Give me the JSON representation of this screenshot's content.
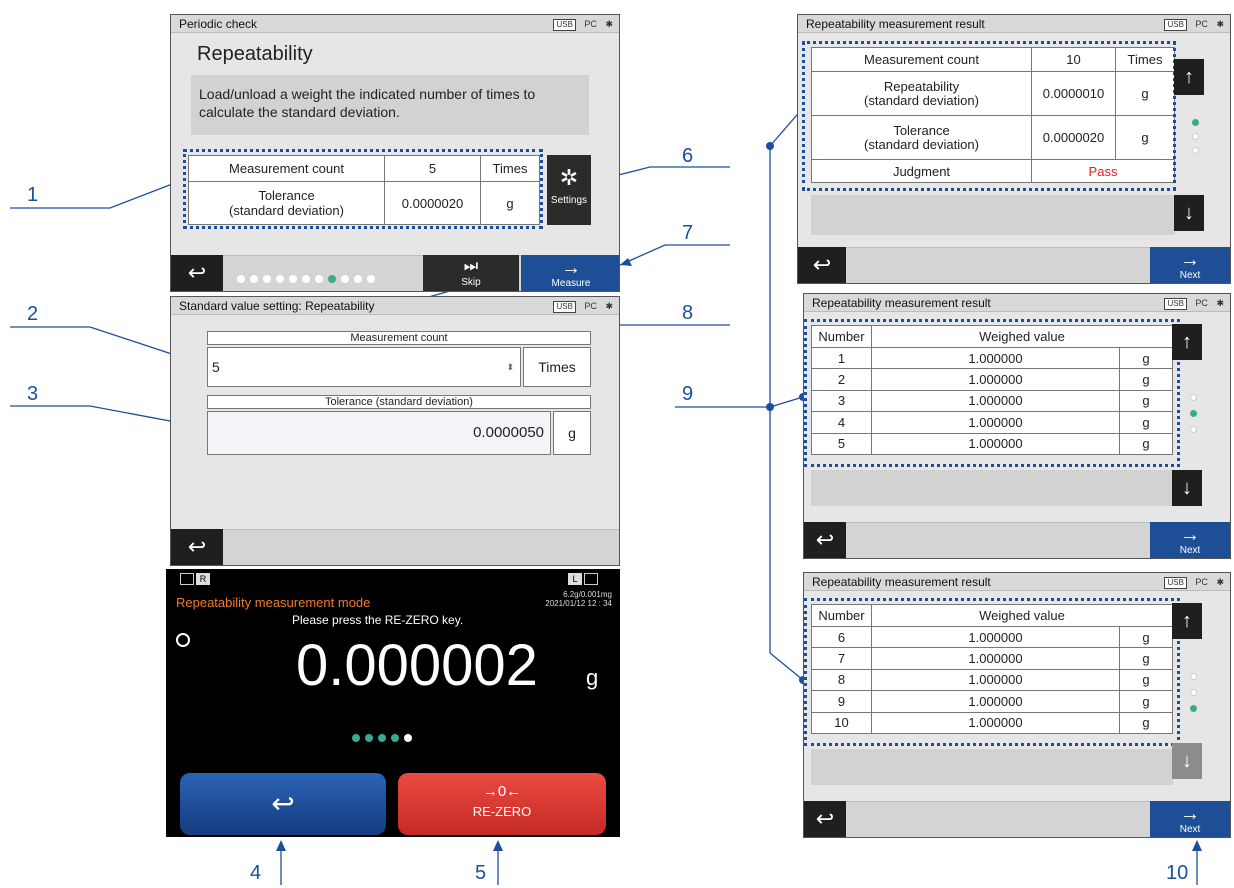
{
  "callouts": [
    "1",
    "2",
    "3",
    "4",
    "5",
    "6",
    "7",
    "8",
    "9",
    "10"
  ],
  "status": {
    "usb": "USB",
    "pc": "PC",
    "bt": "✱"
  },
  "screen_check": {
    "title": "Periodic check",
    "heading": "Repeatability",
    "instruction": "Load/unload a weight the indicated number of times to calculate the standard deviation.",
    "rows": [
      {
        "label": "Measurement count",
        "value": "5",
        "unit": "Times"
      },
      {
        "label": "Tolerance\n(standard deviation)",
        "value": "0.0000020",
        "unit": "g"
      }
    ],
    "settings_label": "Settings",
    "skip_label": "Skip",
    "measure_label": "Measure"
  },
  "screen_setting": {
    "title": "Standard value setting: Repeatability",
    "count_header": "Measurement count",
    "count_value": "5",
    "count_unit": "Times",
    "tol_header": "Tolerance (standard deviation)",
    "tol_value": "0.0000050",
    "tol_unit": "g"
  },
  "screen_measure": {
    "left_badge": "R",
    "right_badge": "L",
    "mode": "Repeatability measurement mode",
    "capacity": "6.2g/0.001mg",
    "datetime": "2021/01/12   12 : 34",
    "prompt": "Please press the RE-ZERO key.",
    "value": "0.000002",
    "unit": "g",
    "rezero_symbol": "→0←",
    "rezero_label": "RE-ZERO"
  },
  "result1": {
    "title": "Repeatability measurement result",
    "rows": [
      {
        "label": "Measurement count",
        "value": "10",
        "unit": "Times"
      },
      {
        "label": "Repeatability\n(standard deviation)",
        "value": "0.0000010",
        "unit": "g"
      },
      {
        "label": "Tolerance\n(standard deviation)",
        "value": "0.0000020",
        "unit": "g"
      },
      {
        "label": "Judgment",
        "value": "Pass",
        "unit": ""
      }
    ],
    "next_label": "Next"
  },
  "result2": {
    "title": "Repeatability measurement result",
    "header_number": "Number",
    "header_value": "Weighed value",
    "rows": [
      {
        "n": "1",
        "v": "1.000000",
        "u": "g"
      },
      {
        "n": "2",
        "v": "1.000000",
        "u": "g"
      },
      {
        "n": "3",
        "v": "1.000000",
        "u": "g"
      },
      {
        "n": "4",
        "v": "1.000000",
        "u": "g"
      },
      {
        "n": "5",
        "v": "1.000000",
        "u": "g"
      }
    ],
    "next_label": "Next"
  },
  "result3": {
    "title": "Repeatability measurement result",
    "header_number": "Number",
    "header_value": "Weighed value",
    "rows": [
      {
        "n": "6",
        "v": "1.000000",
        "u": "g"
      },
      {
        "n": "7",
        "v": "1.000000",
        "u": "g"
      },
      {
        "n": "8",
        "v": "1.000000",
        "u": "g"
      },
      {
        "n": "9",
        "v": "1.000000",
        "u": "g"
      },
      {
        "n": "10",
        "v": "1.000000",
        "u": "g"
      }
    ],
    "next_label": "Next"
  },
  "colors": {
    "accent": "#1b4f9c",
    "pass": "#e02020",
    "dot_active": "#3aa98f",
    "rezero": "#d93a34"
  }
}
